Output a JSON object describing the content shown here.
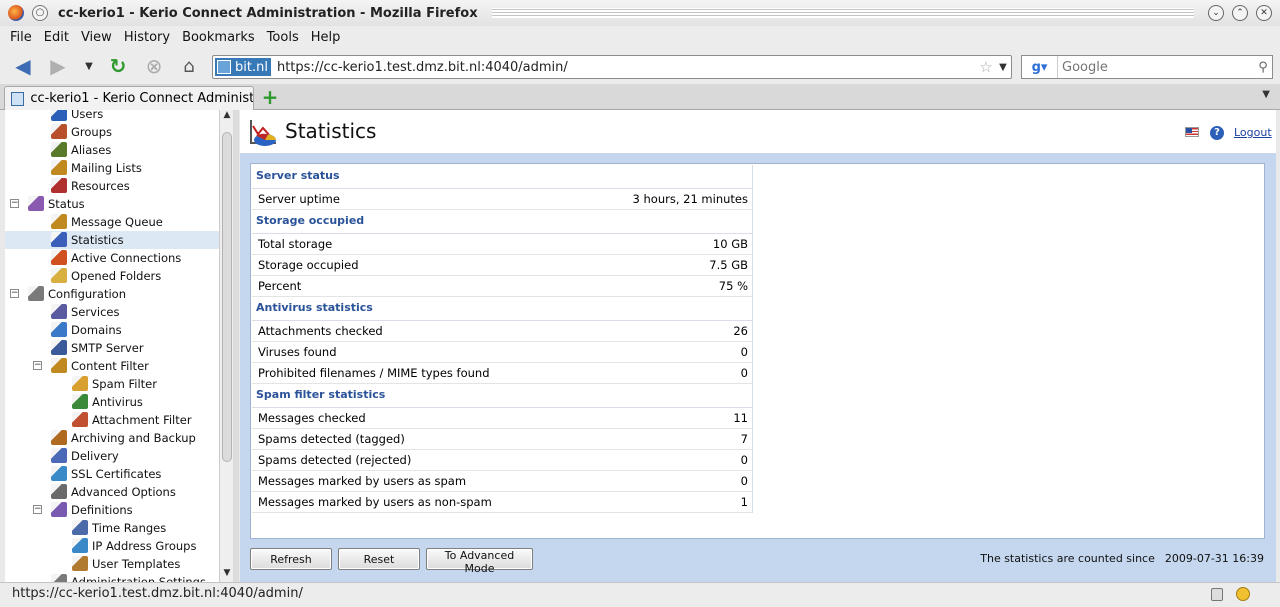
{
  "window": {
    "title": "cc-kerio1 - Kerio Connect Administration - Mozilla Firefox"
  },
  "menubar": {
    "items": [
      "File",
      "Edit",
      "View",
      "History",
      "Bookmarks",
      "Tools",
      "Help"
    ]
  },
  "navbar": {
    "site_identity": "bit.nl",
    "url": "https://cc-kerio1.test.dmz.bit.nl:4040/admin/",
    "search_placeholder": "Google"
  },
  "tabs": [
    {
      "label": "cc-kerio1 - Kerio Connect Administ..."
    }
  ],
  "sidebar": {
    "items": [
      {
        "label": "Users",
        "icon": "users-icon"
      },
      {
        "label": "Groups",
        "icon": "groups-icon"
      },
      {
        "label": "Aliases",
        "icon": "aliases-icon"
      },
      {
        "label": "Mailing Lists",
        "icon": "mailing-lists-icon"
      },
      {
        "label": "Resources",
        "icon": "resources-icon"
      },
      {
        "label": "Status",
        "icon": "status-icon",
        "expanded": true
      },
      {
        "label": "Message Queue",
        "icon": "message-queue-icon"
      },
      {
        "label": "Statistics",
        "icon": "statistics-icon",
        "selected": true
      },
      {
        "label": "Active Connections",
        "icon": "active-connections-icon"
      },
      {
        "label": "Opened Folders",
        "icon": "opened-folders-icon"
      },
      {
        "label": "Configuration",
        "icon": "configuration-icon",
        "expanded": true
      },
      {
        "label": "Services",
        "icon": "services-icon"
      },
      {
        "label": "Domains",
        "icon": "domains-icon"
      },
      {
        "label": "SMTP Server",
        "icon": "smtp-server-icon"
      },
      {
        "label": "Content Filter",
        "icon": "content-filter-icon",
        "expanded": true
      },
      {
        "label": "Spam Filter",
        "icon": "spam-filter-icon"
      },
      {
        "label": "Antivirus",
        "icon": "antivirus-icon"
      },
      {
        "label": "Attachment Filter",
        "icon": "attachment-filter-icon"
      },
      {
        "label": "Archiving and Backup",
        "icon": "archiving-icon"
      },
      {
        "label": "Delivery",
        "icon": "delivery-icon"
      },
      {
        "label": "SSL Certificates",
        "icon": "ssl-certificates-icon"
      },
      {
        "label": "Advanced Options",
        "icon": "advanced-options-icon"
      },
      {
        "label": "Definitions",
        "icon": "definitions-icon",
        "expanded": true
      },
      {
        "label": "Time Ranges",
        "icon": "time-ranges-icon"
      },
      {
        "label": "IP Address Groups",
        "icon": "ip-address-groups-icon"
      },
      {
        "label": "User Templates",
        "icon": "user-templates-icon"
      },
      {
        "label": "Administration Settings",
        "icon": "administration-settings-icon"
      }
    ]
  },
  "header": {
    "title": "Statistics",
    "help_icon": "?",
    "logout": "Logout"
  },
  "stats": {
    "server_status": {
      "title": "Server status",
      "rows": [
        {
          "label": "Server uptime",
          "value": "3 hours, 21 minutes"
        }
      ]
    },
    "storage": {
      "title": "Storage occupied",
      "rows": [
        {
          "label": "Total storage",
          "value": "10 GB"
        },
        {
          "label": "Storage occupied",
          "value": "7.5 GB"
        },
        {
          "label": "Percent",
          "value": "75 %"
        }
      ]
    },
    "antivirus": {
      "title": "Antivirus statistics",
      "rows": [
        {
          "label": "Attachments checked",
          "value": "26"
        },
        {
          "label": "Viruses found",
          "value": "0"
        },
        {
          "label": "Prohibited filenames / MIME types found",
          "value": "0"
        }
      ]
    },
    "spam": {
      "title": "Spam filter statistics",
      "rows": [
        {
          "label": "Messages checked",
          "value": "11"
        },
        {
          "label": "Spams detected (tagged)",
          "value": "7"
        },
        {
          "label": "Spams detected (rejected)",
          "value": "0"
        },
        {
          "label": "Messages marked by users as spam",
          "value": "0"
        },
        {
          "label": "Messages marked by users as non-spam",
          "value": "1"
        }
      ]
    }
  },
  "footer": {
    "refresh": "Refresh",
    "reset": "Reset",
    "advanced": "To Advanced Mode",
    "since_label": "The statistics are counted since",
    "since_value": "2009-07-31 16:39"
  },
  "statusbar": {
    "text": "https://cc-kerio1.test.dmz.bit.nl:4040/admin/"
  }
}
